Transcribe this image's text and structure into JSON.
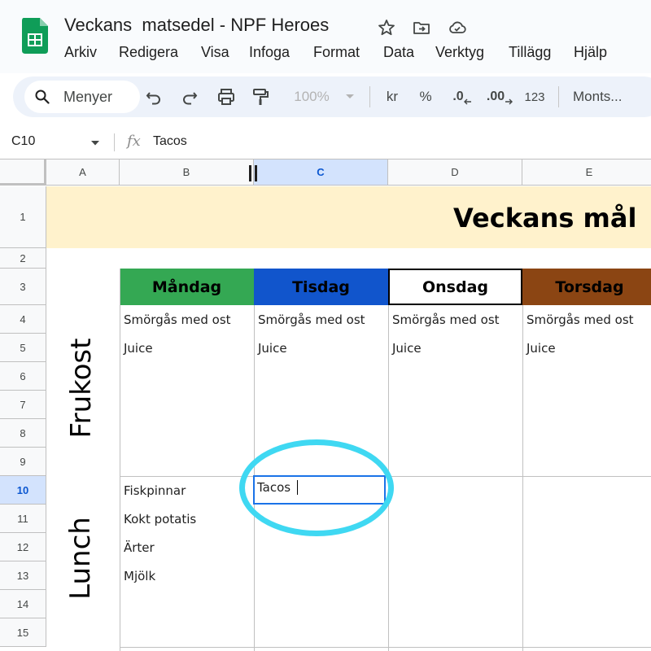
{
  "app": {
    "doc_title": "Veckans  matsedel - NPF Heroes",
    "title_icons": [
      "star-icon",
      "move-to-folder-icon",
      "cloud-saved-icon"
    ]
  },
  "menu": [
    "Arkiv",
    "Redigera",
    "Visa",
    "Infoga",
    "Format",
    "Data",
    "Verktyg",
    "Tillägg",
    "Hjälp"
  ],
  "toolbar": {
    "search_label": "Menyer",
    "zoom": "100%",
    "currency": "kr",
    "percent": "%",
    "decrease_decimals": ".0",
    "increase_decimals": ".00",
    "number_format": "123",
    "font": "Monts..."
  },
  "formula_bar": {
    "cell_ref": "C10",
    "fx": "fx",
    "value": "Tacos"
  },
  "grid": {
    "columns": [
      "A",
      "B",
      "C",
      "D",
      "E"
    ],
    "selected_column": "C",
    "rows": [
      "1",
      "2",
      "3",
      "4",
      "5",
      "6",
      "7",
      "8",
      "9",
      "10",
      "11",
      "12",
      "13",
      "14",
      "15"
    ],
    "selected_row": "10"
  },
  "sheet": {
    "title": "Veckans mål",
    "days": [
      {
        "name": "Måndag",
        "color": "#34a853"
      },
      {
        "name": "Tisdag",
        "color": "#1155cc"
      },
      {
        "name": "Onsdag",
        "color": "#ffffff"
      },
      {
        "name": "Torsdag",
        "color": "#8b4513"
      }
    ],
    "meal_labels": [
      "Frukost",
      "Lunch"
    ],
    "breakfast": {
      "row4": [
        "Smörgås med ost",
        "Smörgås med ost",
        "Smörgås med ost",
        "Smörgås med ost"
      ],
      "row5": [
        "Juice",
        "Juice",
        "Juice",
        "Juice"
      ]
    },
    "lunch_monday": [
      "Fiskpinnar",
      "Kokt potatis",
      "Ärter",
      "Mjölk"
    ],
    "active_cell_text": "Tacos"
  },
  "colors": {
    "title_band": "#fff2cc",
    "selection": "#1a73e8",
    "annotation_ring": "#3fd8f2"
  }
}
